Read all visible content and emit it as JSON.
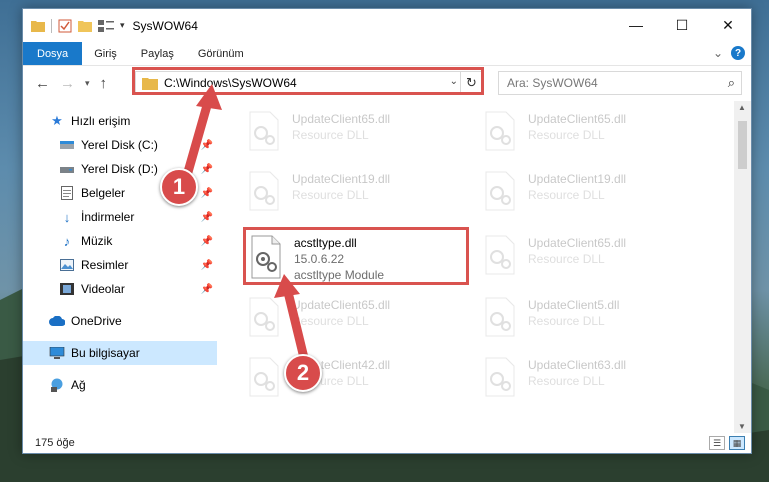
{
  "window": {
    "title": "SysWOW64",
    "controls": {
      "minimize": "—",
      "maximize": "☐",
      "close": "✕"
    }
  },
  "ribbon": {
    "tabs": [
      "Dosya",
      "Giriş",
      "Paylaş",
      "Görünüm"
    ],
    "expand": "⌄",
    "help": "?"
  },
  "address": {
    "path": "C:\\Windows\\SysWOW64",
    "search_placeholder": "Ara: SysWOW64"
  },
  "sidebar": {
    "quick_access": "Hızlı erişim",
    "items": [
      {
        "label": "Yerel Disk (C:)",
        "icon": "drive-icon",
        "pinned": true
      },
      {
        "label": "Yerel Disk (D:)",
        "icon": "drive-icon",
        "pinned": true
      },
      {
        "label": "Belgeler",
        "icon": "documents-icon",
        "pinned": true
      },
      {
        "label": "İndirmeler",
        "icon": "downloads-icon",
        "pinned": true
      },
      {
        "label": "Müzik",
        "icon": "music-icon",
        "pinned": true
      },
      {
        "label": "Resimler",
        "icon": "pictures-icon",
        "pinned": true
      },
      {
        "label": "Videolar",
        "icon": "videos-icon",
        "pinned": true
      }
    ],
    "onedrive": "OneDrive",
    "this_pc": "Bu bilgisayar",
    "network": "Ağ"
  },
  "files": {
    "left": [
      {
        "name": "UpdateClient65.dll",
        "type": "Resource DLL"
      },
      {
        "name": "UpdateClient19.dll",
        "type": "Resource DLL"
      },
      {
        "name": "UpdateClient65.dll",
        "type": "Resource DLL"
      },
      {
        "name": "UpdateClient42.dll",
        "type": "Resource DLL"
      }
    ],
    "right": [
      {
        "name": "UpdateClient65.dll",
        "type": "Resource DLL"
      },
      {
        "name": "UpdateClient19.dll",
        "type": "Resource DLL"
      },
      {
        "name": "UpdateClient65.dll",
        "type": "Resource DLL"
      },
      {
        "name": "UpdateClient5.dll",
        "type": "Resource DLL"
      },
      {
        "name": "UpdateClient63.dll",
        "type": "Resource DLL"
      }
    ],
    "highlight": {
      "name": "acstltype.dll",
      "version": "15.0.6.22",
      "description": "acstltype Module"
    }
  },
  "status": {
    "count": "175 öğe"
  },
  "callouts": {
    "one": "1",
    "two": "2"
  },
  "colors": {
    "accent": "#1979ca",
    "callout": "#d84b4b",
    "selection": "#cce8ff"
  }
}
